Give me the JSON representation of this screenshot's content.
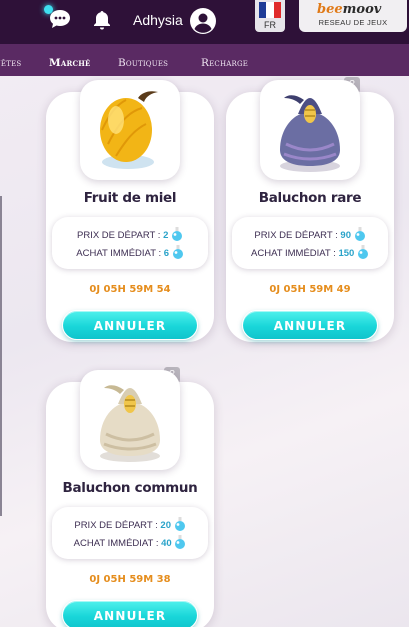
{
  "header": {
    "username": "Adhysia",
    "language": {
      "code": "FR",
      "flag_colors": [
        "#1f3c97",
        "#ffffff",
        "#e02b2b"
      ]
    },
    "brand": {
      "logo_prefix": "bee",
      "logo_suffix": "moov",
      "subtitle": "RESEAU DE JEUX"
    },
    "icons": [
      "chat-icon",
      "bell-icon",
      "avatar-icon"
    ]
  },
  "nav": {
    "items": [
      {
        "label": "Quêtes",
        "active": false
      },
      {
        "label": "Marché",
        "active": true
      },
      {
        "label": "Boutiques",
        "active": false
      },
      {
        "label": "Recharge",
        "active": false
      }
    ]
  },
  "labels": {
    "start_price": "PRIX DE DÉPART :",
    "buyout": "ACHAT IMMÉDIAT :",
    "cancel": "ANNULER"
  },
  "cards": [
    {
      "name": "Fruit de miel",
      "start_price": "2",
      "buyout": "6",
      "timer": "0J 05H 59M 54",
      "item_icon": "honey-fruit-icon",
      "help": false
    },
    {
      "name": "Baluchon rare",
      "start_price": "90",
      "buyout": "150",
      "timer": "0J 05H 59M 49",
      "item_icon": "rare-bundle-icon",
      "help": true
    },
    {
      "name": "Baluchon commun",
      "start_price": "20",
      "buyout": "40",
      "timer": "0J 05H 59M 38",
      "item_icon": "common-bundle-icon",
      "help": true
    }
  ],
  "colors": {
    "header_bg": "#2e1138",
    "nav_bg": "#5a2a63",
    "price_value": "#2aa3c9",
    "timer": "#e58d1d",
    "button": "#19d6d9"
  }
}
